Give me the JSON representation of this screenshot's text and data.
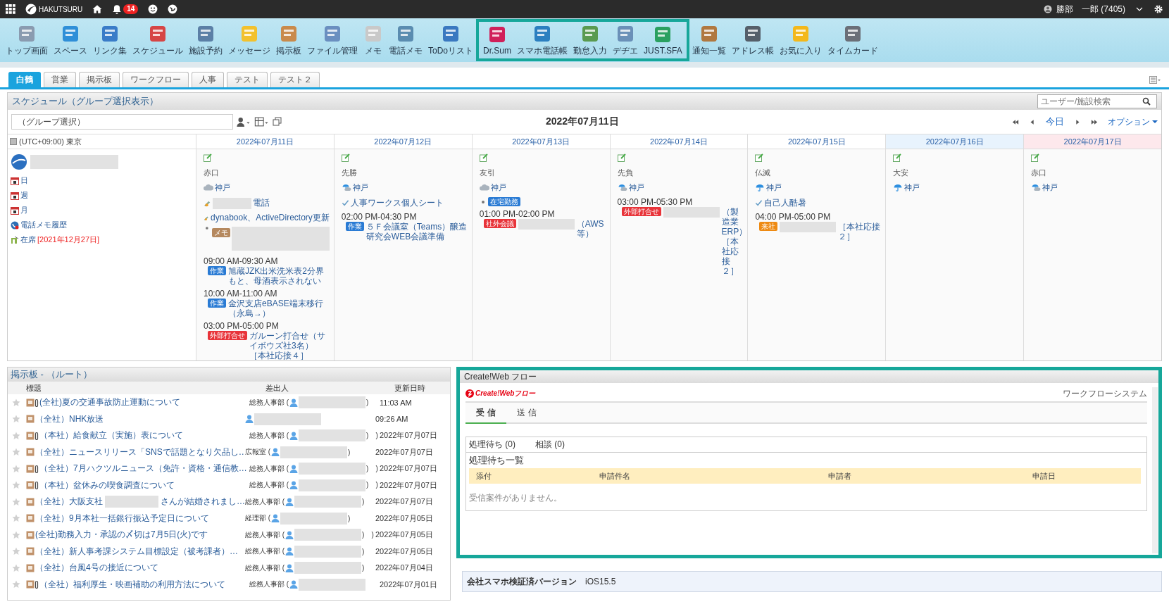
{
  "topbar": {
    "brand": "HAKUTSURU",
    "notification_count": "14",
    "user": "勝部　一郎 (7405)"
  },
  "toolbar": [
    {
      "label": "トップ画面",
      "highlighted": false
    },
    {
      "label": "スペース",
      "highlighted": false
    },
    {
      "label": "リンク集",
      "highlighted": false
    },
    {
      "label": "スケジュール",
      "highlighted": false
    },
    {
      "label": "施設予約",
      "highlighted": false
    },
    {
      "label": "メッセージ",
      "highlighted": false
    },
    {
      "label": "掲示板",
      "highlighted": false
    },
    {
      "label": "ファイル管理",
      "highlighted": false
    },
    {
      "label": "メモ",
      "highlighted": false
    },
    {
      "label": "電話メモ",
      "highlighted": false
    },
    {
      "label": "ToDoリスト",
      "highlighted": false
    },
    {
      "label": "Dr.Sum",
      "highlighted": true
    },
    {
      "label": "スマホ電話帳",
      "highlighted": true
    },
    {
      "label": "勤怠入力",
      "highlighted": true
    },
    {
      "label": "デヂエ",
      "highlighted": true
    },
    {
      "label": "JUST.SFA",
      "highlighted": true
    },
    {
      "label": "通知一覧",
      "highlighted": false
    },
    {
      "label": "アドレス帳",
      "highlighted": false
    },
    {
      "label": "お気に入り",
      "highlighted": false
    },
    {
      "label": "タイムカード",
      "highlighted": false
    }
  ],
  "tabs": [
    {
      "label": "白鶴",
      "selected": true
    },
    {
      "label": "営業",
      "selected": false
    },
    {
      "label": "掲示板",
      "selected": false
    },
    {
      "label": "ワークフロー",
      "selected": false
    },
    {
      "label": "人事",
      "selected": false
    },
    {
      "label": "テスト",
      "selected": false
    },
    {
      "label": "テスト２",
      "selected": false
    }
  ],
  "schedule": {
    "title": "スケジュール（グループ選択表示）",
    "search_placeholder": "ユーザー/施設検索",
    "group_select": "（グループ選択）",
    "date": "2022年07月11日",
    "today": "今日",
    "options": "オプション",
    "timezone": "(UTC+09:00) 東京",
    "links": [
      {
        "kind": "day",
        "label": "日"
      },
      {
        "kind": "week",
        "label": "週"
      },
      {
        "kind": "month",
        "label": "月"
      },
      {
        "kind": "phone",
        "label": "電話メモ履歴"
      },
      {
        "kind": "presence",
        "label": "在席",
        "note": "[2021年12月27日]"
      }
    ],
    "days": [
      {
        "date": "2022年07月11日",
        "kind": "weekday",
        "rokuyo": "赤口",
        "place": "神戸",
        "entries": [
          {
            "kind": "note",
            "redacted": true,
            "text": "電話"
          },
          {
            "kind": "note",
            "redacted": false,
            "text": "dynabook、ActiveDirectory更新"
          },
          {
            "kind": "memo",
            "tag": "メモ",
            "color": "#b5885e"
          },
          {
            "kind": "event",
            "time": "09:00 AM-09:30 AM",
            "tag": "作業",
            "color": "#2a7bd4",
            "redacted": false,
            "text": "旭蔵JZK出米洗米表2分界もと、母酒表示されない"
          },
          {
            "kind": "event",
            "time": "10:00 AM-11:00 AM",
            "tag": "作業",
            "color": "#2a7bd4",
            "redacted": false,
            "text": "金沢支店eBASE端末移行（永島→）"
          },
          {
            "kind": "event",
            "time": "03:00 PM-05:00 PM",
            "tag": "外部打合せ",
            "color": "#e8343a",
            "redacted": false,
            "text": "ガルーン打合せ（サイボウズ社3名）［本社応接４］"
          }
        ]
      },
      {
        "date": "2022年07月12日",
        "kind": "weekday",
        "rokuyo": "先勝",
        "place": "神戸",
        "entries": [
          {
            "kind": "todo",
            "redacted": false,
            "text": "人事ワークス個人シート"
          },
          {
            "kind": "event",
            "time": "02:00 PM-04:30 PM",
            "tag": "作業",
            "color": "#2a7bd4",
            "redacted": false,
            "text": "５Ｆ会議室（Teams）醸造研究会WEB会議準備"
          }
        ]
      },
      {
        "date": "2022年07月13日",
        "kind": "weekday",
        "rokuyo": "友引",
        "place": "神戸",
        "entries": [
          {
            "kind": "status",
            "tag": "在宅勤務",
            "color": "#2a7bd4"
          },
          {
            "kind": "event",
            "time": "01:00 PM-02:00 PM",
            "tag": "社外会議",
            "color": "#e8343a",
            "redacted": true,
            "text": "（AWS等）"
          }
        ]
      },
      {
        "date": "2022年07月14日",
        "kind": "weekday",
        "rokuyo": "先負",
        "place": "神戸",
        "entries": [
          {
            "kind": "event",
            "time": "03:00 PM-05:30 PM",
            "tag": "外部打合せ",
            "color": "#e8343a",
            "redacted": true,
            "text": "（製造業ERP）［本社応接２］"
          }
        ]
      },
      {
        "date": "2022年07月15日",
        "kind": "weekday",
        "rokuyo": "仏滅",
        "place": "神戸",
        "entries": [
          {
            "kind": "todo",
            "redacted": false,
            "text": "自己人酷暑"
          },
          {
            "kind": "event",
            "time": "04:00 PM-05:00 PM",
            "tag": "来社",
            "color": "#ee8a12",
            "redacted": true,
            "text": "［本社応接２］"
          }
        ]
      },
      {
        "date": "2022年07月16日",
        "kind": "saturday",
        "rokuyo": "大安",
        "place": "神戸"
      },
      {
        "date": "2022年07月17日",
        "kind": "sunday",
        "rokuyo": "赤口",
        "place": "神戸"
      }
    ]
  },
  "bulletin": {
    "title": "掲示板 - （ルート）",
    "columns": [
      "標題",
      "差出人",
      "更新日時"
    ],
    "rows": [
      {
        "starred": false,
        "attachment": true,
        "title": "(全社)夏の交通事故防止運動について",
        "sender": "総務人事部 (",
        "sender_close": ")",
        "date": "11:03 AM"
      },
      {
        "starred": false,
        "attachment": false,
        "title": "（全社）NHK放送",
        "date": "09:26 AM"
      },
      {
        "starred": false,
        "attachment": true,
        "title": "（本社）給食献立（実施）表について",
        "sender": "総務人事部 (",
        "sender_close": ")　)",
        "date": "2022年07月07日"
      },
      {
        "starred": false,
        "attachment": false,
        "title": "（全社）ニュースリリース「SNSで話題となり欠品し…",
        "sender": "広報室 (",
        "sender_close": ")",
        "date": "2022年07月07日"
      },
      {
        "starred": false,
        "attachment": true,
        "title": "（全社）7月ハクツルニュース（免許・資格・通信教…",
        "sender": "総務人事部 (",
        "sender_close": ")　)",
        "date": "2022年07月07日"
      },
      {
        "starred": false,
        "attachment": true,
        "title": "（本社）盆休みの喫食調査について",
        "sender": "総務人事部 (",
        "sender_close": ")　)",
        "date": "2022年07月07日"
      },
      {
        "starred": false,
        "attachment": false,
        "title": "（全社）大阪支社",
        "title_after": "さんが結婚されまし…",
        "sender": "総務人事部 (",
        "sender_close": ")",
        "date": "2022年07月07日"
      },
      {
        "starred": false,
        "attachment": false,
        "title": "（全社）9月本社一括銀行振込予定日について",
        "sender": "経理部 (",
        "sender_close": ")",
        "date": "2022年07月05日"
      },
      {
        "starred": false,
        "attachment": false,
        "title": "(全社)勤務入力・承認の〆切は7月5日(火)です",
        "sender": "総務人事部 (",
        "sender_close": ")　)",
        "date": "2022年07月05日"
      },
      {
        "starred": false,
        "attachment": false,
        "title": "（全社）新人事考課システム目標設定（被考課者）…",
        "sender": "総務人事部 (",
        "sender_close": ")",
        "date": "2022年07月05日"
      },
      {
        "starred": false,
        "attachment": false,
        "title": "（全社）台風4号の接近について",
        "sender": "総務人事部 (",
        "sender_close": ")",
        "date": "2022年07月04日"
      },
      {
        "starred": false,
        "attachment": true,
        "title": "（全社）福利厚生・映画補助の利用方法について",
        "sender": "総務人事部 (",
        "date": "2022年07月01日"
      }
    ]
  },
  "workflow": {
    "highlighted": true,
    "title": "Create!Web フロー",
    "logo": "Create!Webフロー",
    "system": "ワークフローシステム",
    "tabs": [
      {
        "label": "受 信",
        "selected": true
      },
      {
        "label": "送 信",
        "selected": false
      }
    ],
    "subtabs": [
      "処理待ち (0)",
      "相談 (0)"
    ],
    "heading": "処理待ち一覧",
    "columns": [
      "添付",
      "申請件名",
      "申請者",
      "申請日"
    ],
    "empty": "受信案件がありません。"
  },
  "footer": {
    "label": "会社スマホ検証済バージョン",
    "value": "iOS15.5"
  }
}
